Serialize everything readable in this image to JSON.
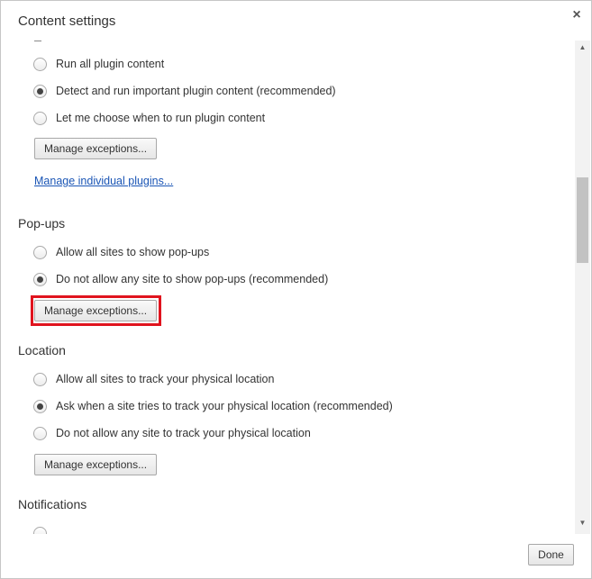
{
  "dialog": {
    "title": "Content settings",
    "close_glyph": "×",
    "done_label": "Done"
  },
  "plugins": {
    "options": [
      {
        "label": "Run all plugin content",
        "checked": false
      },
      {
        "label": "Detect and run important plugin content (recommended)",
        "checked": true
      },
      {
        "label": "Let me choose when to run plugin content",
        "checked": false
      }
    ],
    "manage_exceptions_label": "Manage exceptions...",
    "manage_individual_link": "Manage individual plugins..."
  },
  "popups": {
    "title": "Pop-ups",
    "options": [
      {
        "label": "Allow all sites to show pop-ups",
        "checked": false
      },
      {
        "label": "Do not allow any site to show pop-ups (recommended)",
        "checked": true
      }
    ],
    "manage_exceptions_label": "Manage exceptions...",
    "highlight_color": "#e0141e"
  },
  "location": {
    "title": "Location",
    "options": [
      {
        "label": "Allow all sites to track your physical location",
        "checked": false
      },
      {
        "label": "Ask when a site tries to track your physical location (recommended)",
        "checked": true
      },
      {
        "label": "Do not allow any site to track your physical location",
        "checked": false
      }
    ],
    "manage_exceptions_label": "Manage exceptions..."
  },
  "notifications": {
    "title": "Notifications"
  },
  "scrollbar": {
    "up_arrow": "▲",
    "down_arrow": "▼"
  },
  "colors": {
    "link": "#1a55b5",
    "text": "#333333"
  }
}
